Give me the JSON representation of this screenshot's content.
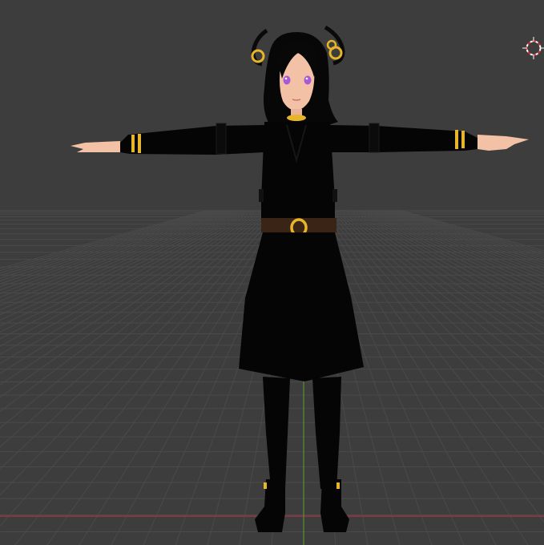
{
  "viewport": {
    "background": "#3d3d3d",
    "grid_color": "#4a4a4a",
    "axis_x_color": "#b0343f",
    "axis_y_color": "#5b8f2e"
  },
  "scene": {
    "object": "character-model",
    "pose": "T-pose",
    "colors": {
      "outfit": "#050505",
      "skin": "#f3c1a6",
      "gold": "#e7b52a",
      "belt": "#3a2415",
      "eyes": "#a85ad6"
    }
  },
  "overlay": {
    "cursor_icon": "3d-cursor-icon"
  }
}
